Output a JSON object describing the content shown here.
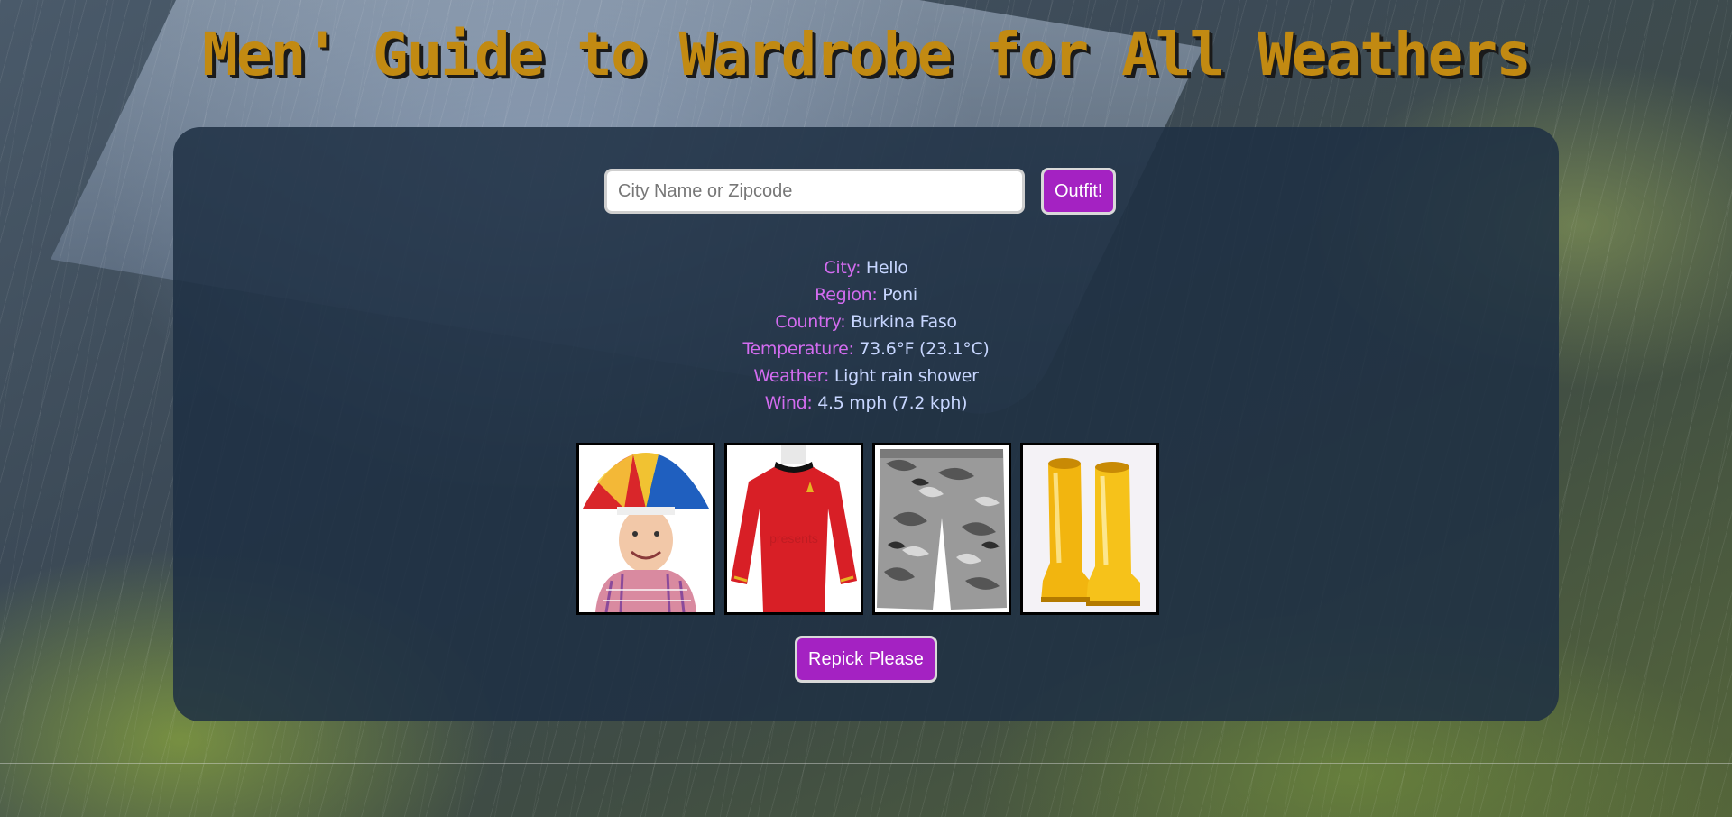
{
  "page": {
    "title": "Men' Guide to Wardrobe for All Weathers"
  },
  "search": {
    "placeholder": "City Name or Zipcode",
    "value": "",
    "button_label": "Outfit!"
  },
  "weather": {
    "city_label": "City:",
    "city": "Hello",
    "region_label": "Region:",
    "region": "Poni",
    "country_label": "Country:",
    "country": "Burkina Faso",
    "temperature_label": "Temperature:",
    "temperature": "73.6°F (23.1°C)",
    "condition_label": "Weather:",
    "condition": "Light rain shower",
    "wind_label": "Wind:",
    "wind": "4.5 mph (7.2 kph)"
  },
  "outfit": {
    "items": [
      {
        "name": "umbrella-hat-image"
      },
      {
        "name": "red-shirt-image"
      },
      {
        "name": "camo-shorts-image"
      },
      {
        "name": "yellow-rain-boots-image"
      }
    ],
    "shirt_watermark": "presents"
  },
  "repick": {
    "button_label": "Repick Please"
  },
  "colors": {
    "title": "#c28a12",
    "button": "#a422c2",
    "label": "#d36cf0",
    "value": "#c7d6ff"
  }
}
